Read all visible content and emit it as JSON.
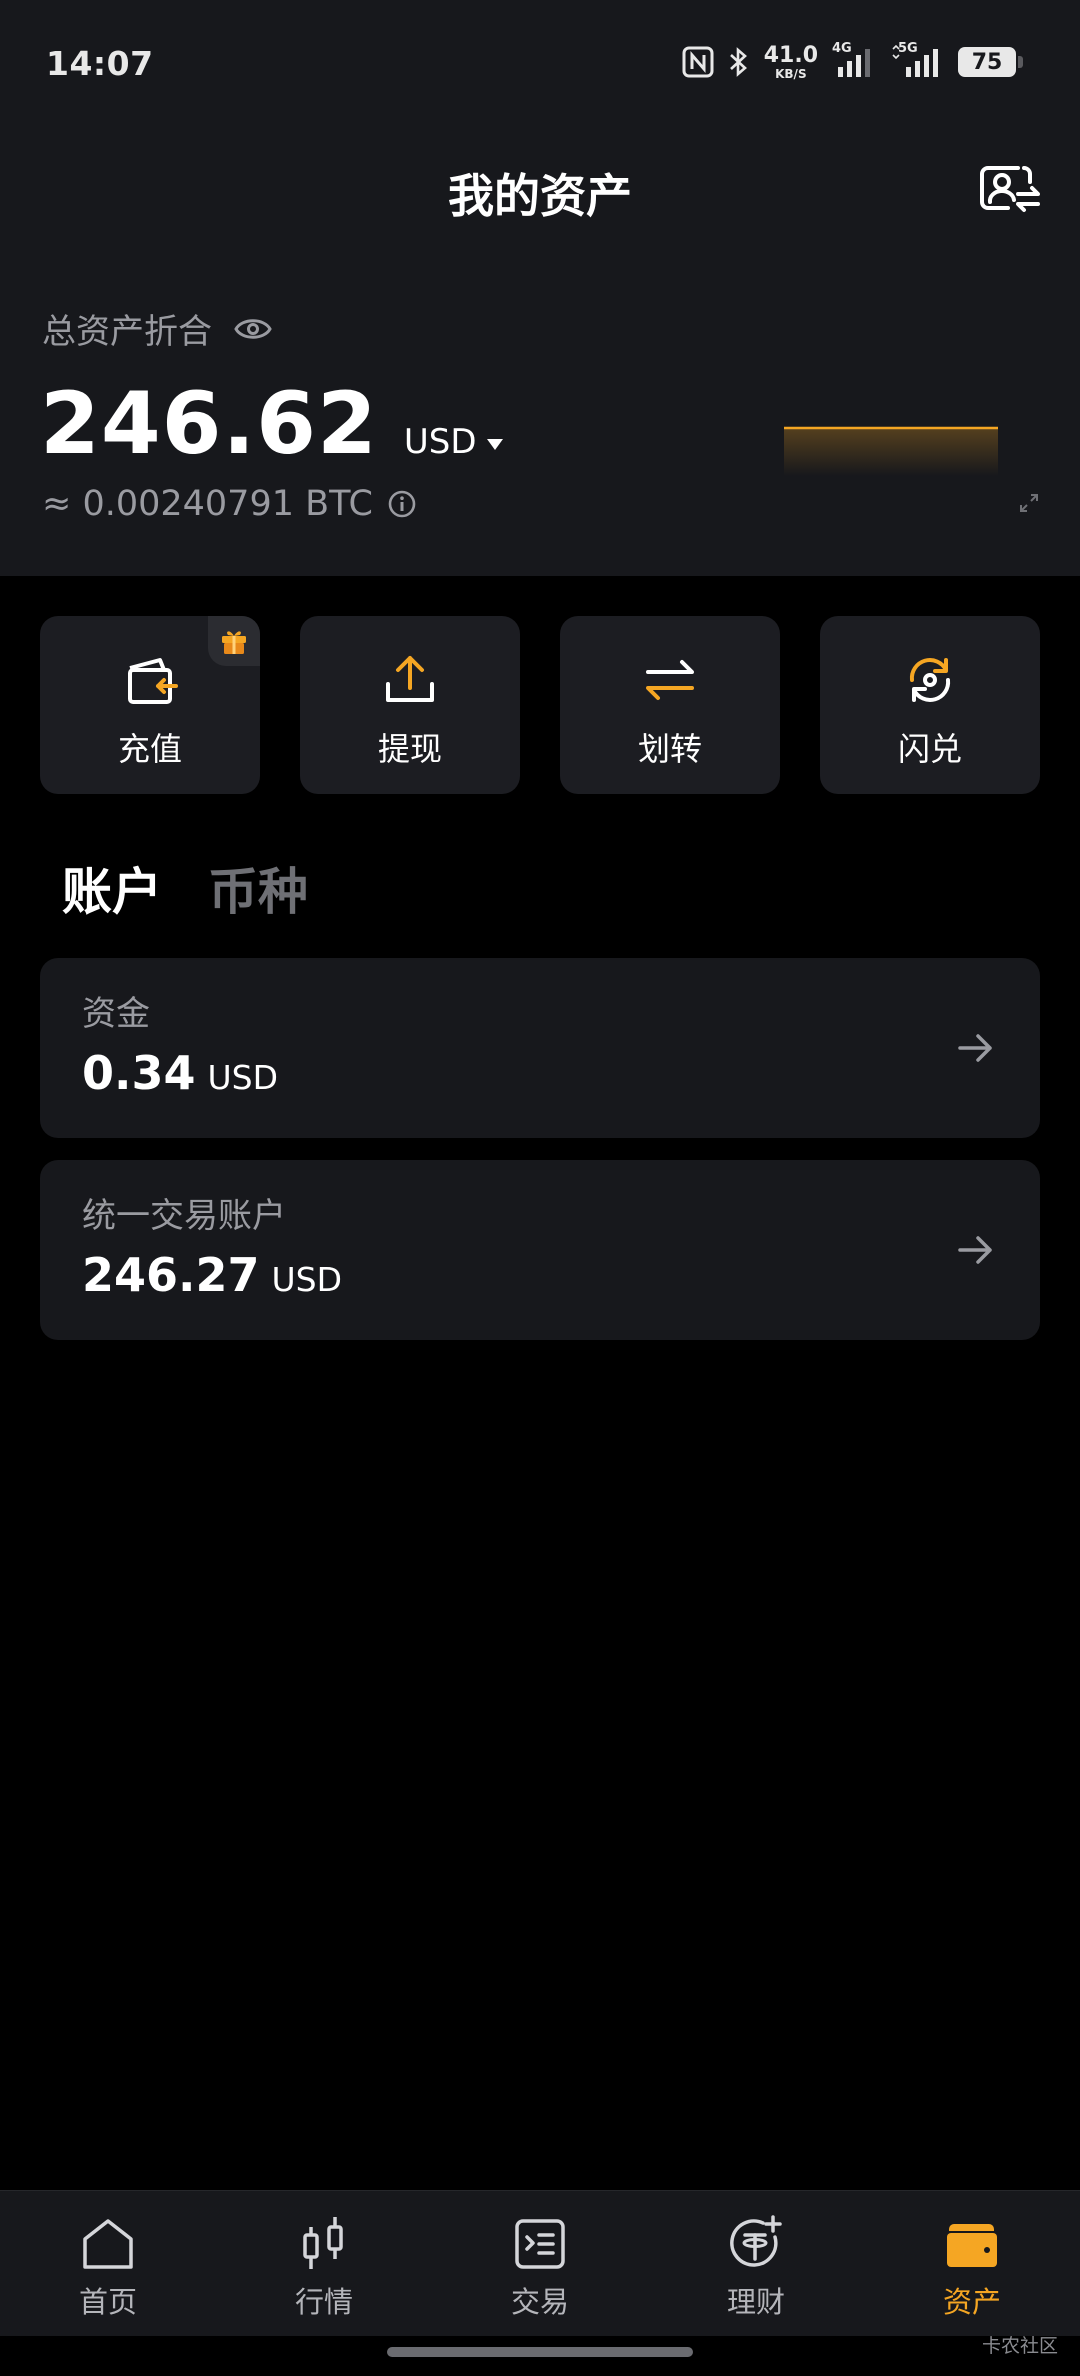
{
  "status_bar": {
    "time": "14:07",
    "net_speed_value": "41.0",
    "net_speed_unit": "KB/S",
    "signal_1_label": "4G",
    "signal_2_label": "5G",
    "battery": "75"
  },
  "header": {
    "title": "我的资产"
  },
  "summary": {
    "label": "总资产折合",
    "value": "246.62",
    "currency": "USD",
    "btc_equivalent": "≈ 0.00240791 BTC"
  },
  "actions": [
    {
      "label": "充值",
      "icon": "deposit-icon"
    },
    {
      "label": "提现",
      "icon": "withdraw-icon"
    },
    {
      "label": "划转",
      "icon": "transfer-icon"
    },
    {
      "label": "闪兑",
      "icon": "convert-icon"
    }
  ],
  "tabs": [
    {
      "label": "账户",
      "active": true
    },
    {
      "label": "币种",
      "active": false
    }
  ],
  "accounts": [
    {
      "name": "资金",
      "value": "0.34",
      "unit": "USD"
    },
    {
      "name": "统一交易账户",
      "value": "246.27",
      "unit": "USD"
    }
  ],
  "bottom_nav": [
    {
      "label": "首页",
      "icon": "home-icon",
      "active": false
    },
    {
      "label": "行情",
      "icon": "candlestick-icon",
      "active": false
    },
    {
      "label": "交易",
      "icon": "trade-icon",
      "active": false
    },
    {
      "label": "理财",
      "icon": "earn-icon",
      "active": false
    },
    {
      "label": "资产",
      "icon": "wallet-icon",
      "active": true
    }
  ],
  "colors": {
    "accent": "#f5a623",
    "background": "#000000",
    "surface": "#17181c",
    "card": "#1c1d22",
    "muted_text": "#9a9ba1"
  },
  "watermark": "卡农社区"
}
